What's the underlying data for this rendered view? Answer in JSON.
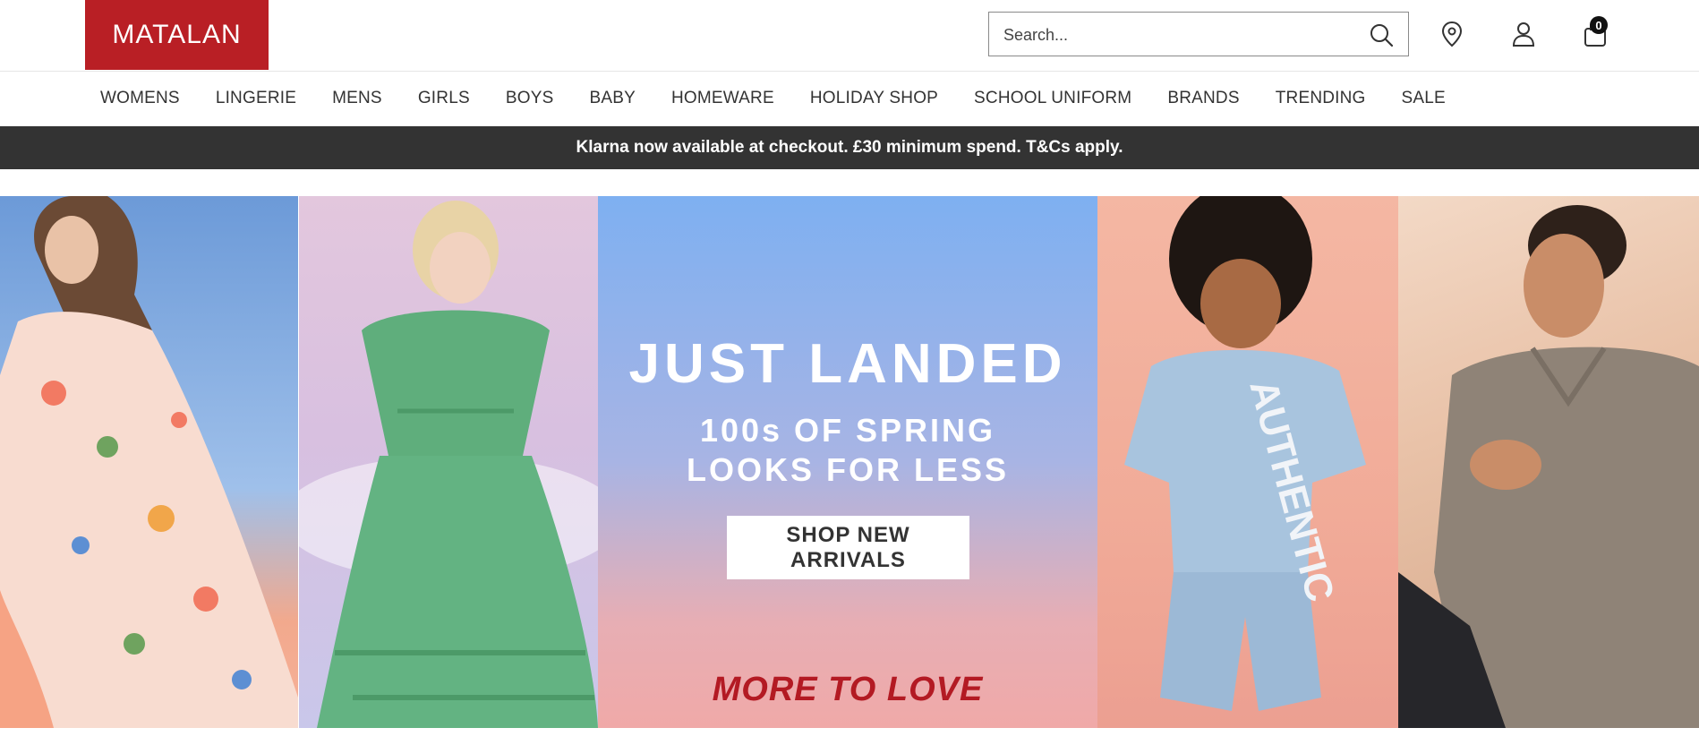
{
  "brand": {
    "logo_text": "MATALAN",
    "color": "#b91f25"
  },
  "search": {
    "placeholder": "Search..."
  },
  "header_icons": [
    "search-icon",
    "store-locator-icon",
    "account-icon",
    "bag-icon"
  ],
  "cart": {
    "count": "0"
  },
  "nav": {
    "items": [
      "WOMENS",
      "LINGERIE",
      "MENS",
      "GIRLS",
      "BOYS",
      "BABY",
      "HOMEWARE",
      "HOLIDAY SHOP",
      "SCHOOL UNIFORM",
      "BRANDS",
      "TRENDING",
      "SALE"
    ]
  },
  "promo": {
    "text": "Klarna now available at checkout. £30 minimum spend. T&Cs apply.",
    "background": "#333333"
  },
  "hero": {
    "title": "JUST LANDED",
    "subtitle": "100s OF SPRING LOOKS FOR LESS",
    "button_label": "SHOP NEW ARRIVALS",
    "footer_text": "MORE TO LOVE",
    "footer_color": "#b31a23"
  }
}
